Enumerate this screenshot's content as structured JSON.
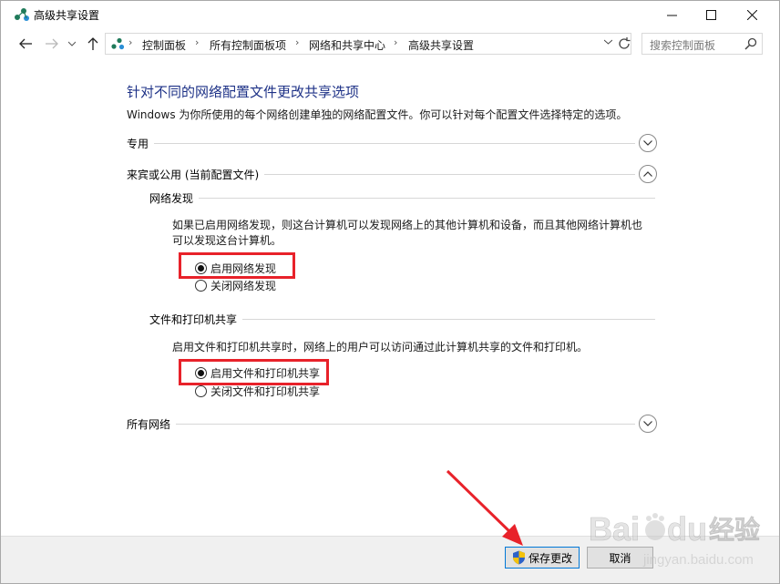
{
  "window": {
    "title": "高级共享设置",
    "minimize_glyph": "—",
    "maximize_glyph": "☐",
    "close_glyph": "✕"
  },
  "nav": {
    "back_icon": "arrow-left-icon",
    "forward_icon": "arrow-right-icon",
    "recent_icon": "chevron-down-icon",
    "up_icon": "arrow-up-icon"
  },
  "address": {
    "breadcrumbs": [
      "控制面板",
      "所有控制面板项",
      "网络和共享中心",
      "高级共享设置"
    ],
    "separator": "›"
  },
  "search": {
    "placeholder": "搜索控制面板"
  },
  "main": {
    "heading": "针对不同的网络配置文件更改共享选项",
    "description": "Windows 为你所使用的每个网络创建单独的网络配置文件。你可以针对每个配置文件选择特定的选项。",
    "profiles": [
      {
        "label": "专用",
        "expanded": false
      },
      {
        "label": "来宾或公用 (当前配置文件)",
        "expanded": true
      },
      {
        "label": "所有网络",
        "expanded": false
      }
    ],
    "network_discovery": {
      "title": "网络发现",
      "text_line1": "如果已启用网络发现，则这台计算机可以发现网络上的其他计算机和设备，而且其他网络计算机也",
      "text_line2": "可以发现这台计算机。",
      "options": [
        {
          "label": "启用网络发现",
          "selected": true
        },
        {
          "label": "关闭网络发现",
          "selected": false
        }
      ]
    },
    "file_sharing": {
      "title": "文件和打印机共享",
      "text": "启用文件和打印机共享时，网络上的用户可以访问通过此计算机共享的文件和打印机。",
      "options": [
        {
          "label": "启用文件和打印机共享",
          "selected": true
        },
        {
          "label": "关闭文件和打印机共享",
          "selected": false
        }
      ]
    }
  },
  "footer": {
    "save_label": "保存更改",
    "cancel_label": "取消"
  },
  "annotations": {
    "highlight_color": "#e8222a"
  },
  "watermark": {
    "brand": "Baidu",
    "brand_suffix": "经验",
    "url": "jingyan.baidu.com"
  }
}
